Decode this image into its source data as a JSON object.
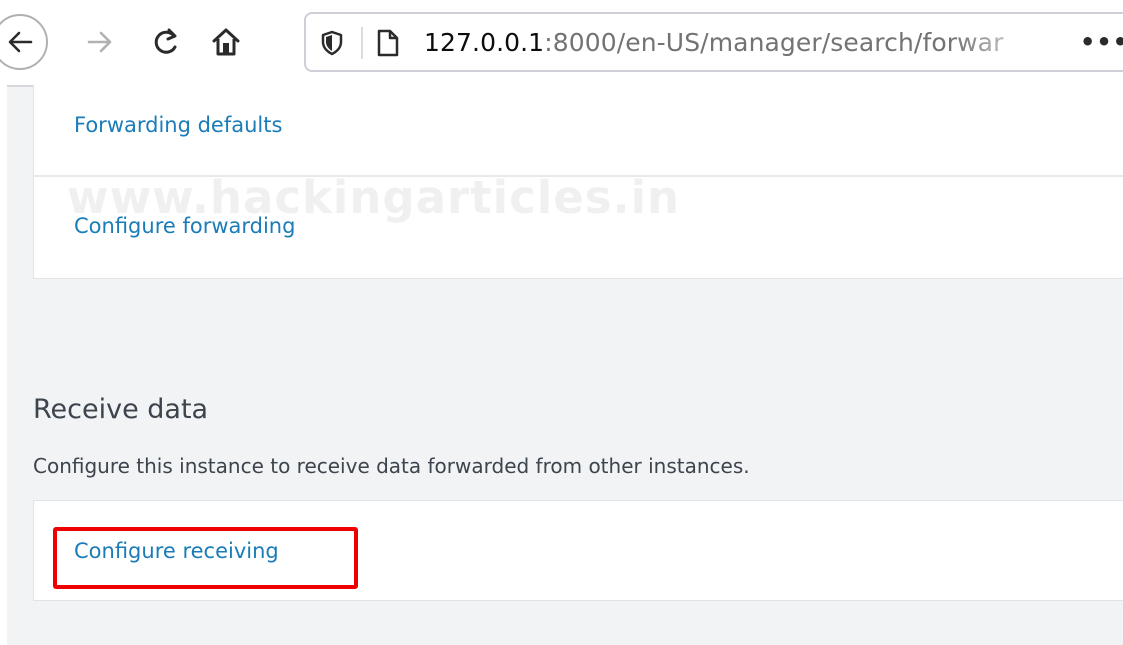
{
  "browser": {
    "url_host": "127.0.0.1",
    "url_rest": ":8000/en-US/manager/search/forwar",
    "more_label": "•••"
  },
  "forwarding": {
    "links": [
      "Forwarding defaults",
      "Configure forwarding"
    ]
  },
  "watermark": "www.hackingarticles.in",
  "receive": {
    "title": "Receive data",
    "description": "Configure this instance to receive data forwarded from other instances.",
    "link": "Configure receiving"
  },
  "colors": {
    "link": "#1a7cb8",
    "highlight": "#ee0000",
    "background": "#f2f3f4"
  }
}
